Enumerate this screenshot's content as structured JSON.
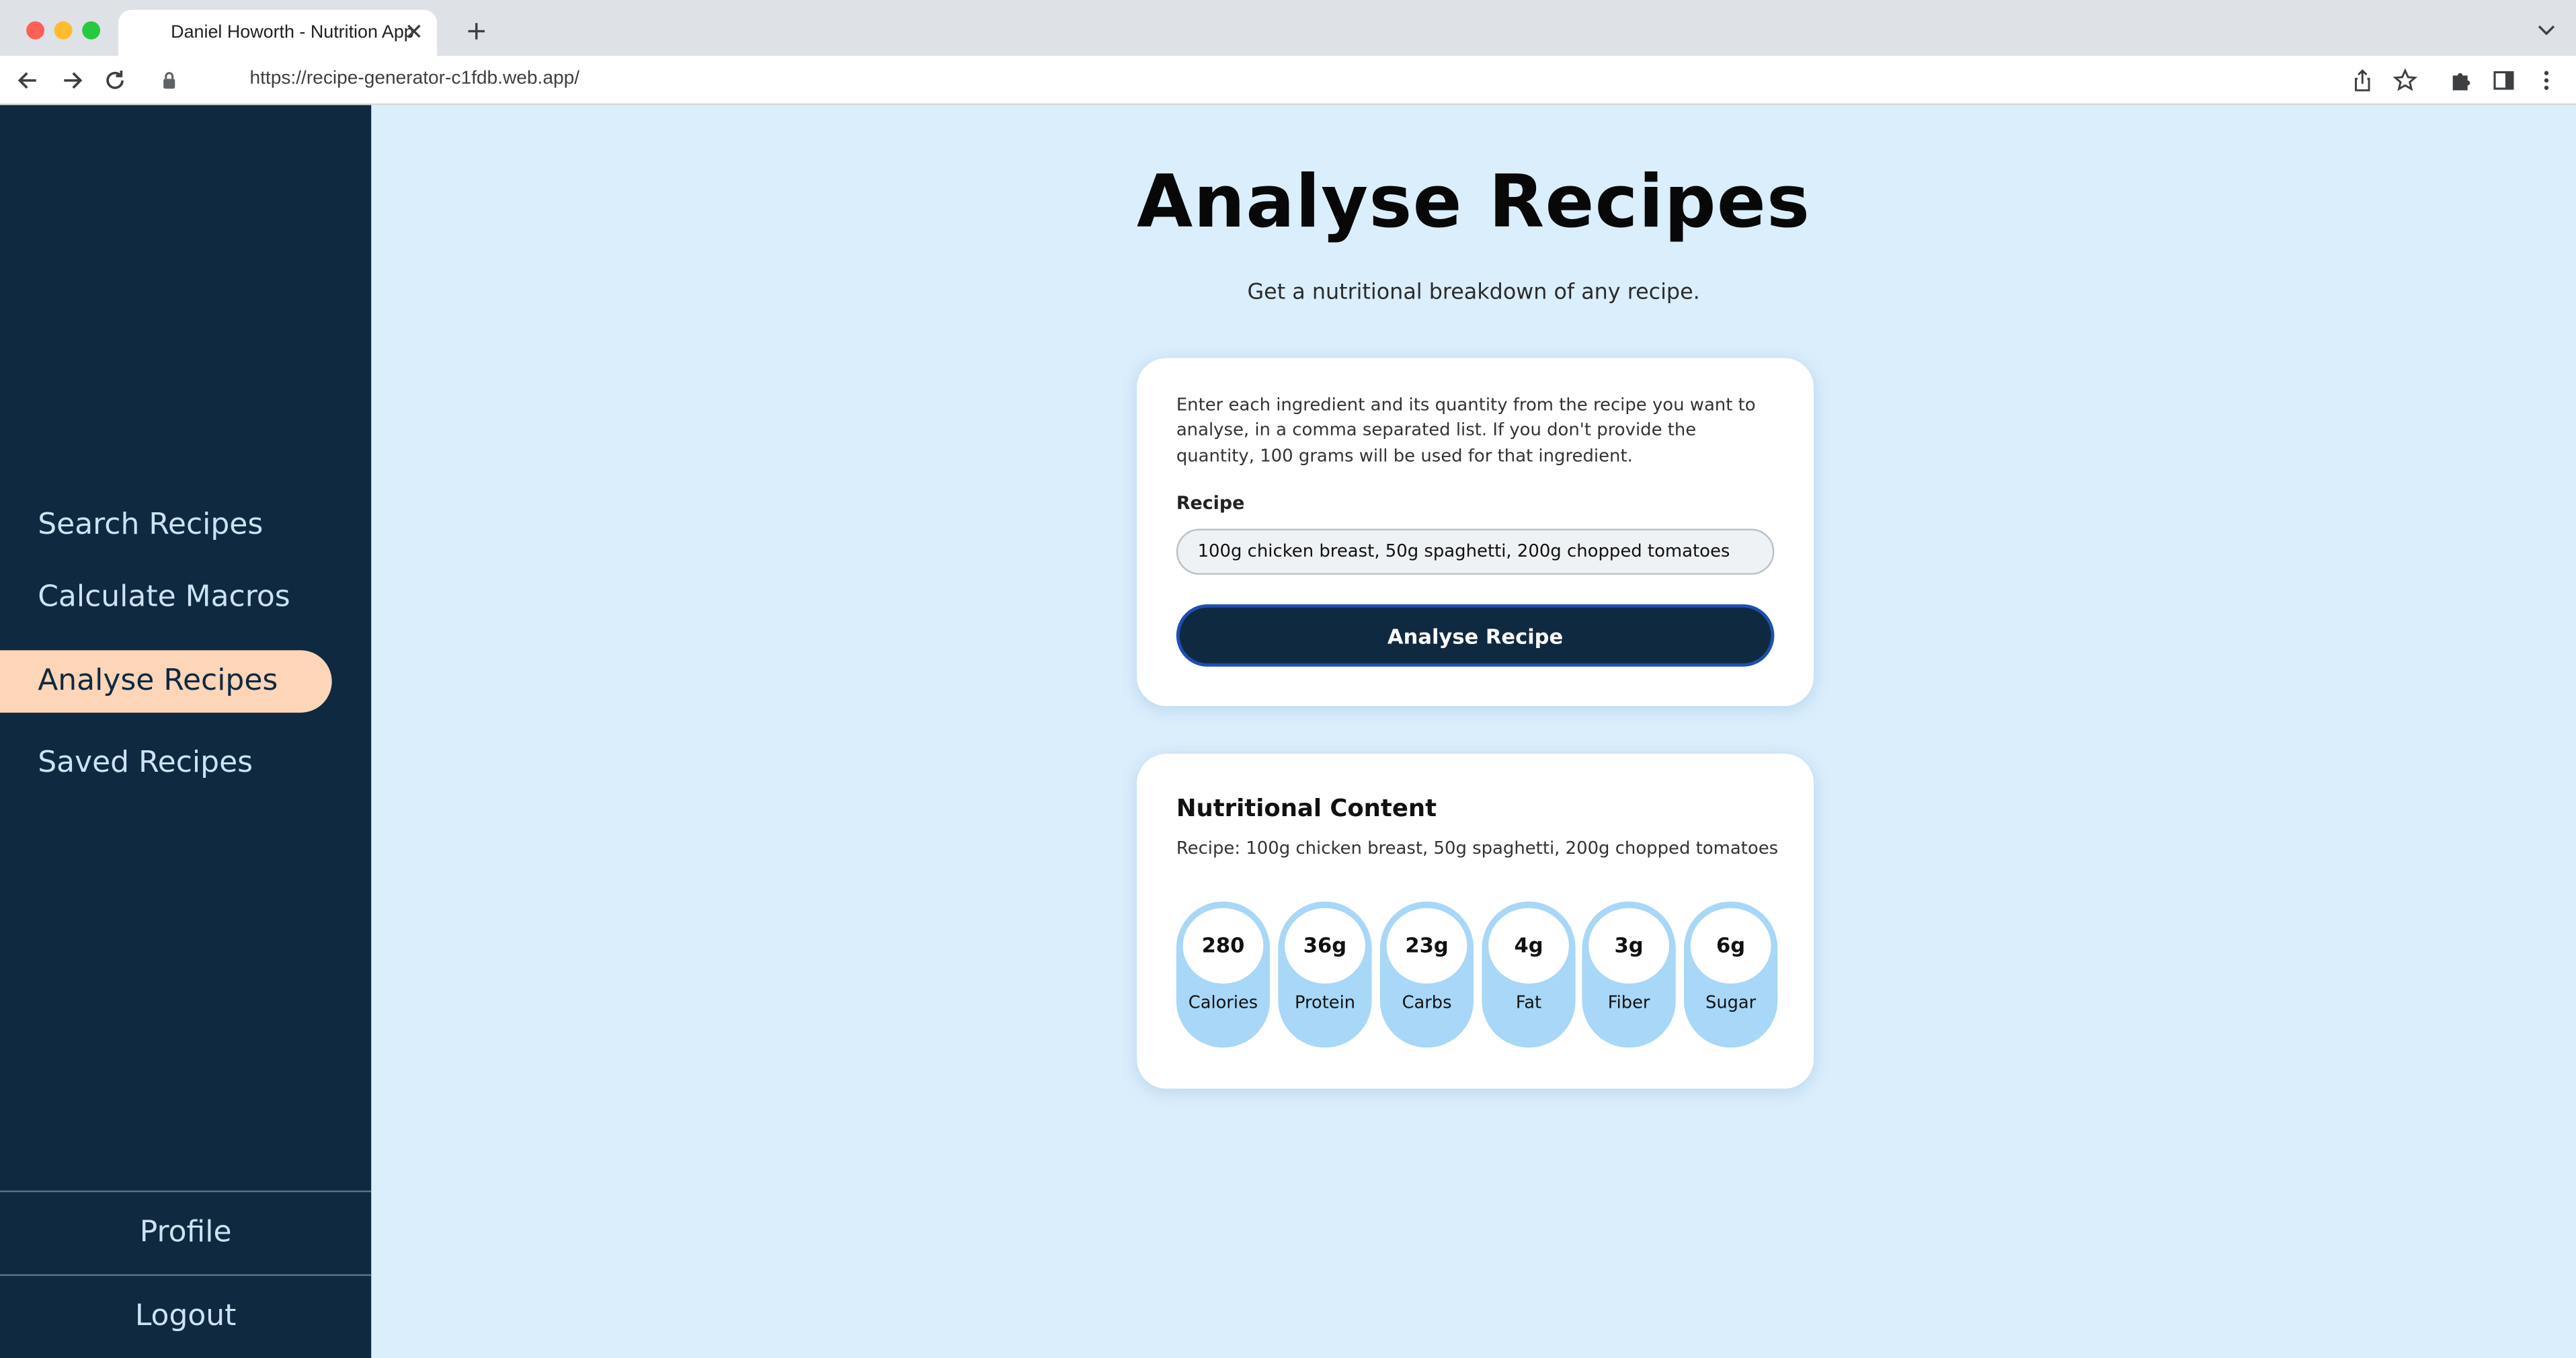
{
  "browser": {
    "tab_title": "Daniel Howorth - Nutrition App",
    "url": "https://recipe-generator-c1fdb.web.app/"
  },
  "sidebar": {
    "items": [
      {
        "label": "Search Recipes",
        "active": false
      },
      {
        "label": "Calculate Macros",
        "active": false
      },
      {
        "label": "Analyse Recipes",
        "active": true
      },
      {
        "label": "Saved Recipes",
        "active": false
      }
    ],
    "profile_label": "Profile",
    "logout_label": "Logout"
  },
  "main": {
    "title": "Analyse Recipes",
    "subtitle": "Get a nutritional breakdown of any recipe."
  },
  "form": {
    "instructions": "Enter each ingredient and its quantity from the recipe you want to analyse, in a comma separated list. If you don't provide the quantity, 100 grams will be used for that ingredient.",
    "recipe_label": "Recipe",
    "recipe_value": "100g chicken breast, 50g spaghetti, 200g chopped tomatoes",
    "button_label": "Analyse Recipe"
  },
  "results": {
    "title": "Nutritional Content",
    "recipe_line": "Recipe: 100g chicken breast, 50g spaghetti, 200g chopped tomatoes",
    "nutrients": [
      {
        "value": "280",
        "label": "Calories"
      },
      {
        "value": "36g",
        "label": "Protein"
      },
      {
        "value": "23g",
        "label": "Carbs"
      },
      {
        "value": "4g",
        "label": "Fat"
      },
      {
        "value": "3g",
        "label": "Fiber"
      },
      {
        "value": "6g",
        "label": "Sugar"
      }
    ]
  },
  "colors": {
    "sidebar_bg": "#0f2940",
    "active_nav": "#fdd5b8",
    "page_bg": "#dbeefc",
    "pill_bg": "#a8d7f7"
  }
}
